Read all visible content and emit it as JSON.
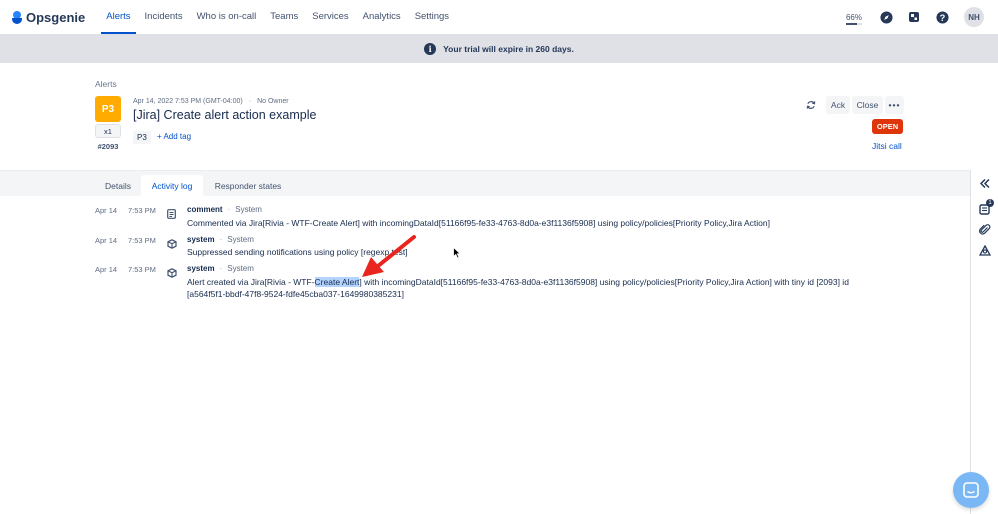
{
  "brand": {
    "name": "Opsgenie"
  },
  "nav": {
    "items": [
      {
        "label": "Alerts",
        "active": true
      },
      {
        "label": "Incidents"
      },
      {
        "label": "Who is on-call"
      },
      {
        "label": "Teams"
      },
      {
        "label": "Services"
      },
      {
        "label": "Analytics"
      },
      {
        "label": "Settings"
      }
    ],
    "progress_label": "66%",
    "progress_value": 66,
    "avatar_initials": "NH"
  },
  "banner": {
    "text": "Your trial will expire in 260 days."
  },
  "alert": {
    "breadcrumb": "Alerts",
    "priority": "P3",
    "count": "x1",
    "tiny_id": "#2093",
    "created": "Apr 14, 2022 7:53 PM (GMT-04:00)",
    "owner": "No Owner",
    "title": "[Jira] Create alert action example",
    "tags": [
      "P3"
    ],
    "add_tag_label": "+ Add tag",
    "actions": {
      "ack": "Ack",
      "close": "Close",
      "more": "•••"
    },
    "status": "OPEN",
    "jitsi_label": "Jitsi call"
  },
  "tabs": [
    {
      "label": "Details"
    },
    {
      "label": "Activity log",
      "active": true
    },
    {
      "label": "Responder states"
    }
  ],
  "activity": [
    {
      "date": "Apr 14",
      "time": "7:53 PM",
      "type": "comment",
      "source": "System",
      "icon": "note-icon",
      "text": "Commented via Jira[Rivia - WTF-Create Alert] with incomingDataId[51166f95-fe33-4763-8d0a-e3f1136f5908] using policy/policies[Priority Policy,Jira Action]"
    },
    {
      "date": "Apr 14",
      "time": "7:53 PM",
      "type": "system",
      "source": "System",
      "icon": "cube-icon",
      "text": "Suppressed sending notifications using policy [regexp test]"
    },
    {
      "date": "Apr 14",
      "time": "7:53 PM",
      "type": "system",
      "source": "System",
      "icon": "cube-icon",
      "text_before": "Alert created via Jira[Rivia - WTF-",
      "text_highlight": "Create Alert",
      "text_after": "] with incomingDataId[51166f95-fe33-4763-8d0a-e3f1136f5908] using policy/policies[Priority Policy,Jira Action] with tiny id [2093] id",
      "text_line2": "[a564f5f1-bbdf-47f8-9524-fdfe45cba037-1649980385231]"
    }
  ],
  "rail": {
    "badge_count": "1"
  },
  "colors": {
    "primary": "#0052cc",
    "priority_p3": "#ffab00",
    "status_open": "#de350b",
    "annotation_arrow": "#e8261f"
  }
}
